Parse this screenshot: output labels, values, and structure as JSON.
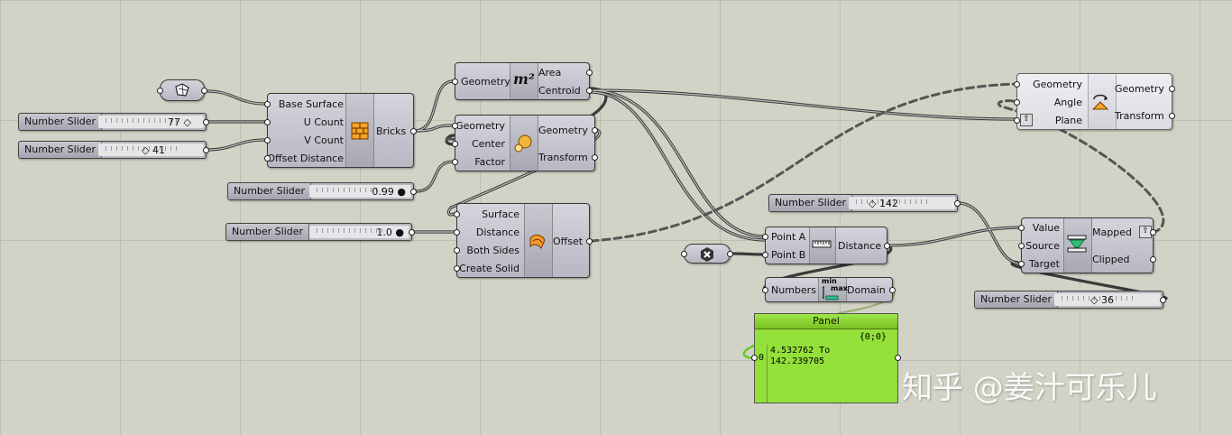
{
  "sliders": [
    {
      "name": "Number Slider",
      "value": "77 ◇"
    },
    {
      "name": "Number Slider",
      "value": "◇ 41"
    },
    {
      "name": "Number Slider",
      "value": "0.99 ●"
    },
    {
      "name": "Number Slider",
      "value": "1.0 ●"
    },
    {
      "name": "Number Slider",
      "value": "◇ 142"
    },
    {
      "name": "Number Slider",
      "value": "◇ 36"
    }
  ],
  "components": {
    "bricks": {
      "inputs": [
        "Base Surface",
        "U Count",
        "V Count",
        "Offset Distance"
      ],
      "outputs": [
        "Bricks"
      ]
    },
    "area": {
      "inputs": [
        "Geometry"
      ],
      "outputs": [
        "Area",
        "Centroid"
      ],
      "icon_text": "m²"
    },
    "scale": {
      "inputs": [
        "Geometry",
        "Center",
        "Factor"
      ],
      "outputs": [
        "Geometry",
        "Transform"
      ]
    },
    "offset": {
      "inputs": [
        "Surface",
        "Distance",
        "Both Sides",
        "Create Solid"
      ],
      "outputs": [
        "Offset"
      ]
    },
    "rotate": {
      "inputs": [
        "Geometry",
        "Angle",
        "Plane"
      ],
      "outputs": [
        "Geometry",
        "Transform"
      ]
    },
    "distance": {
      "inputs": [
        "Point A",
        "Point B"
      ],
      "outputs": [
        "Distance"
      ]
    },
    "bounds": {
      "inputs": [
        "Numbers"
      ],
      "outputs": [
        "Domain"
      ],
      "icon_top": "min",
      "icon_bottom": "max"
    },
    "remap": {
      "inputs": [
        "Value",
        "Source",
        "Target"
      ],
      "outputs": [
        "Mapped",
        "Clipped"
      ]
    }
  },
  "panel": {
    "title": "Panel",
    "path": "{0;0}",
    "index": "0",
    "lines": [
      "4.532762 To",
      "142.239705"
    ]
  },
  "watermark": "知乎 @姜汁可乐儿"
}
